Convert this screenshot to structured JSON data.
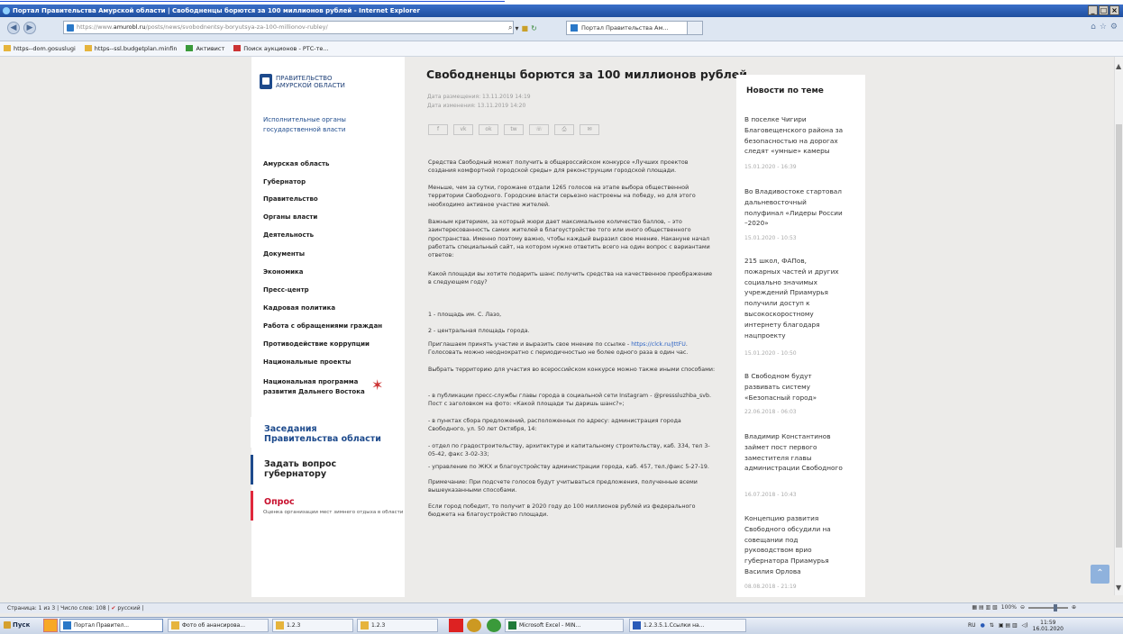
{
  "browser": {
    "window_title": "Портал Правительства Амурской области | Свободненцы борются за 100 миллионов рублей - Internet Explorer",
    "url_prefix": "https://www.",
    "url_domain": "amurobl.ru",
    "url_path": "/posts/news/svobodnentsy-boryutsya-za-100-millionov-rubley/",
    "tab_label": "Портал Правительства Ам...",
    "favorites": [
      "https--dom.gosuslugi",
      "https--ssl.budgetplan.minfin",
      "Активист",
      "Поиск аукционов - РТС-те..."
    ]
  },
  "site": {
    "logo_line1": "Правительство",
    "logo_line2": "Амурской области",
    "exec_link_line1": "Исполнительные органы",
    "exec_link_line2": "государственной власти",
    "menu": [
      "Амурская область",
      "Губернатор",
      "Правительство",
      "Органы власти",
      "Деятельность",
      "Документы",
      "Экономика",
      "Пресс-центр",
      "Кадровая политика",
      "Работа с обращениями граждан",
      "Противодействие коррупции",
      "Национальные проекты"
    ],
    "menu_dv_line1": "Национальная программа",
    "menu_dv_line2": "развития Дальнего Востока",
    "block_meetings_line1": "Заседания",
    "block_meetings_line2": "Правительства области",
    "block_question_line1": "Задать вопрос",
    "block_question_line2": "губернатору",
    "block_poll": "Опрос",
    "block_poll_desc": "Оценка организации мест зимнего отдыха в области"
  },
  "article": {
    "title": "Свободненцы борются за 100 миллионов рублей",
    "date_posted": "Дата размещения: 13.11.2019 14:19",
    "date_changed": "Дата изменения: 13.11.2019 14:20",
    "share_icons": [
      "f",
      "vk",
      "ok",
      "tw",
      "wa",
      "print",
      "mail"
    ],
    "paragraphs": [
      "Средства Свободный может получить в общероссийском конкурсе «Лучших проектов создания комфортной городской среды» для реконструкции городской площади.",
      "Меньше, чем за сутки, горожане отдали 1265 голосов на этапе выбора общественной территории Свободного. Городские власти серьезно настроены на победу, но для этого необходимо активное участие жителей.",
      "Важным критерием, за который жюри дает максимальное количество баллов, – это заинтересованность самих жителей в благоустройстве того или иного общественного пространства. Именно поэтому важно, чтобы каждый выразил свое мнение.  Накануне начал работать специальный сайт, на котором нужно ответить всего на один вопрос с вариантами ответов:",
      "Какой площади вы хотите подарить шанс получить средства на качественное преображение в следующем году?",
      "1 - площадь им. С. Лазо,",
      "2 - центральная площадь города.",
      "Приглашаем принять участие и выразить свое мнение по ссылке - ",
      "Голосовать можно неоднократно с периодичностью не более одного раза в один час.",
      "Выбрать территорию для участия во всероссийском конкурсе можно также иными способами:",
      "- в публикации пресс-службы главы города в социальной сети Instagram - @presssluzhba_svb. Пост с заголовком на фото: «Какой площади ты даришь шанс?»;",
      "- в пунктах сбора предложений, расположенных по адресу: администрация города Свободного, ул. 50 лет Октября, 14:",
      "- отдел по градостроительству, архитектуре и капитальному строительству, каб. 334, тел 3-05-42, факс 3-02-33;",
      "- управление по ЖКХ и благоустройству администрации города, каб. 457, тел./факс 5-27-19.",
      "Примечание: При подсчете голосов будут учитываться предложения, полученные всеми вышеуказанными способами.",
      "Если город победит, то получит в 2020 году до 100 миллионов рублей из федерального бюджета на благоустройство площади."
    ],
    "link_text": "https://clck.ru/JttFU",
    "link_suffix": "."
  },
  "news": {
    "heading": "Новости по теме",
    "items": [
      {
        "title": "В поселке Чигири Благовещенского района за безопасностью на дорогах следят «умные» камеры",
        "date": "15.01.2020 - 16:39"
      },
      {
        "title": "Во Владивостоке стартовал дальневосточный полуфинал «Лидеры России –2020»",
        "date": "15.01.2020 - 10:53"
      },
      {
        "title": "215 школ, ФАПов, пожарных частей и других социально значимых учреждений Приамурья получили доступ к высокоскоростному интернету благодаря нацпроекту",
        "date": "15.01.2020 - 10:50"
      },
      {
        "title": "В Свободном будут развивать систему «Безопасный город»",
        "date": "22.06.2018 - 06:03"
      },
      {
        "title": "Владимир Константинов займет пост первого заместителя главы администрации Свободного",
        "date": "16.07.2018 - 10:43"
      },
      {
        "title": "Концепцию развития Свободного обсудили на совещании под руководством врио губернатора Приамурья Василия Орлова",
        "date": "08.08.2018 - 21:19"
      }
    ]
  },
  "statusbar": {
    "page": "Страница: 1 из 3",
    "words": "Число слов: 108",
    "lang": "русский",
    "zoom": "100%"
  },
  "taskbar": {
    "start": "Пуск",
    "items": [
      "Портал Правител...",
      "Фото об анансирова...",
      "1.2.3",
      "1.2.3",
      "Microsoft Excel - MIN...",
      "1.2.3.5.1.Ссылки на..."
    ],
    "lang": "RU",
    "time": "11:59",
    "date": "16.01.2020"
  }
}
